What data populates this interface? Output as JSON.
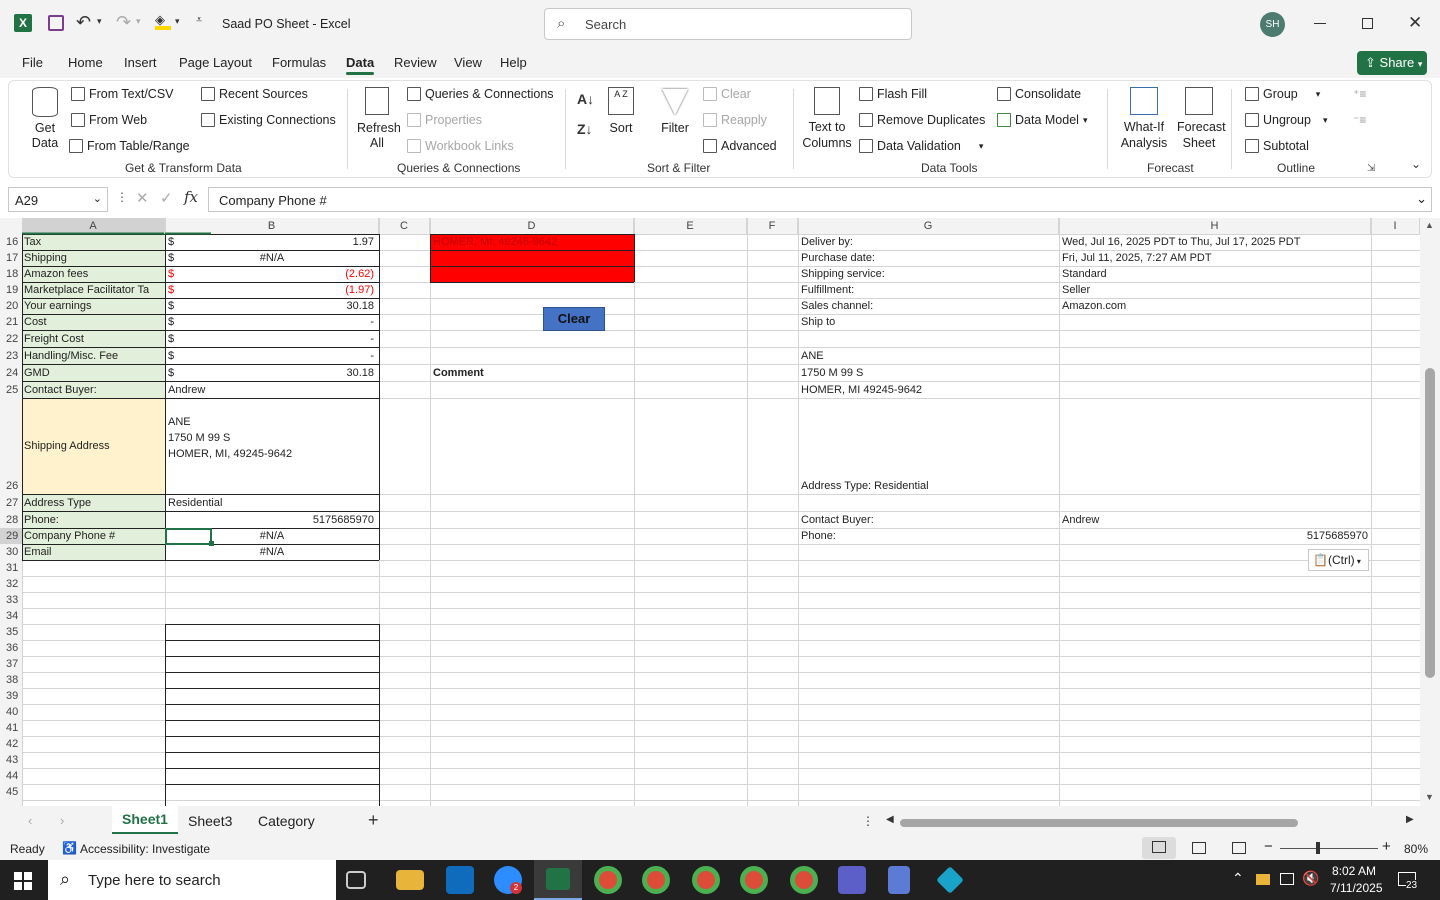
{
  "window": {
    "title": "Saad PO Sheet - Excel",
    "search_placeholder": "Search",
    "avatar": "SH"
  },
  "menu": {
    "tabs": [
      "File",
      "Home",
      "Insert",
      "Page Layout",
      "Formulas",
      "Data",
      "Review",
      "View",
      "Help"
    ],
    "active": "Data",
    "share": "Share"
  },
  "ribbon": {
    "get_data": "Get Data",
    "from_text": "From Text/CSV",
    "from_web": "From Web",
    "from_table": "From Table/Range",
    "recent": "Recent Sources",
    "existing": "Existing Connections",
    "grp_get": "Get & Transform Data",
    "refresh": "Refresh All",
    "queries": "Queries & Connections",
    "properties": "Properties",
    "workbook_links": "Workbook Links",
    "grp_queries": "Queries & Connections",
    "sort": "Sort",
    "filter": "Filter",
    "clear": "Clear",
    "reapply": "Reapply",
    "advanced": "Advanced",
    "grp_sort": "Sort & Filter",
    "text_to_columns": "Text to Columns",
    "flash_fill": "Flash Fill",
    "remove_dup": "Remove Duplicates",
    "data_validation": "Data Validation",
    "consolidate": "Consolidate",
    "data_model": "Data Model",
    "grp_tools": "Data Tools",
    "what_if": "What-If Analysis",
    "forecast_sheet": "Forecast Sheet",
    "grp_forecast": "Forecast",
    "group": "Group",
    "ungroup": "Ungroup",
    "subtotal": "Subtotal",
    "grp_outline": "Outline"
  },
  "formula_bar": {
    "name_box": "A29",
    "formula": "Company Phone #"
  },
  "columns": [
    "A",
    "B",
    "C",
    "D",
    "E",
    "F",
    "G",
    "H",
    "I"
  ],
  "rows": [
    "16",
    "17",
    "18",
    "19",
    "20",
    "21",
    "22",
    "23",
    "24",
    "25",
    "26",
    "27",
    "28",
    "29",
    "30",
    "31",
    "32",
    "33",
    "34",
    "35",
    "36",
    "37",
    "38",
    "39",
    "40",
    "41",
    "42",
    "43",
    "44",
    "45"
  ],
  "labels": {
    "r16": "Tax",
    "r17": "Shipping",
    "r18": "Amazon fees",
    "r19": "Marketplace Facilitator Ta",
    "r20": "Your earnings",
    "r21": "Cost",
    "r22": "Freight Cost",
    "r23": "Handling/Misc. Fee",
    "r24": "GMD",
    "r25": "Contact Buyer:",
    "r26": "Shipping Address",
    "r27": "Address Type",
    "r28": "Phone:",
    "r29": "Company Phone #",
    "r30": "Email"
  },
  "values": {
    "cur": "$",
    "r16": "1.97",
    "r17": "#N/A",
    "r18": "(2.62)",
    "r19": "(1.97)",
    "r20": "30.18",
    "r21": "-",
    "r22": "-",
    "r23": "-",
    "r24": "30.18",
    "r25": "Andrew",
    "r26a": "ANE",
    "r26b": "1750 M 99 S",
    "r26c": "HOMER, MI, 49245-9642",
    "r27": "Residential",
    "r28": "5175685970",
    "r29": "#N/A",
    "r30": "#N/A"
  },
  "d_col": {
    "r16": "HOMER, MI, 49245-9642",
    "clear_btn": "Clear",
    "comment": "Comment"
  },
  "details": {
    "g16": "Deliver by:",
    "h16": "Wed, Jul 16, 2025 PDT to Thu, Jul 17, 2025 PDT",
    "g17": "Purchase date:",
    "h17": "Fri, Jul 11, 2025, 7:27 AM PDT",
    "g18": "Shipping service:",
    "h18": "Standard",
    "g19": "Fulfillment:",
    "h19": "Seller",
    "g20": "Sales channel:",
    "h20": "Amazon.com",
    "g21": "Ship to",
    "g23": "ANE",
    "g24": "1750 M 99 S",
    "g25": "HOMER, MI 49245-9642",
    "g26": "Address Type:  Residential",
    "g28": "Contact Buyer:",
    "h28": "Andrew",
    "g29": "Phone:",
    "h29": "5175685970",
    "paste": "(Ctrl)"
  },
  "sheets": {
    "tabs": [
      "Sheet1",
      "Sheet3",
      "Category"
    ],
    "active": "Sheet1"
  },
  "status": {
    "ready": "Ready",
    "accessibility": "Accessibility: Investigate",
    "zoom": "80%"
  },
  "taskbar": {
    "search": "Type here to search",
    "time": "8:02 AM",
    "date": "7/11/2025",
    "notif": "23",
    "zoom_badge": "2"
  },
  "colors": {
    "excel_green": "#217346",
    "label_fill": "#e2efda",
    "value_fill": "#fff2cc",
    "red_fill": "#ff0000",
    "clear_btn": "#4472c4",
    "grid": "#d4d4d4"
  }
}
